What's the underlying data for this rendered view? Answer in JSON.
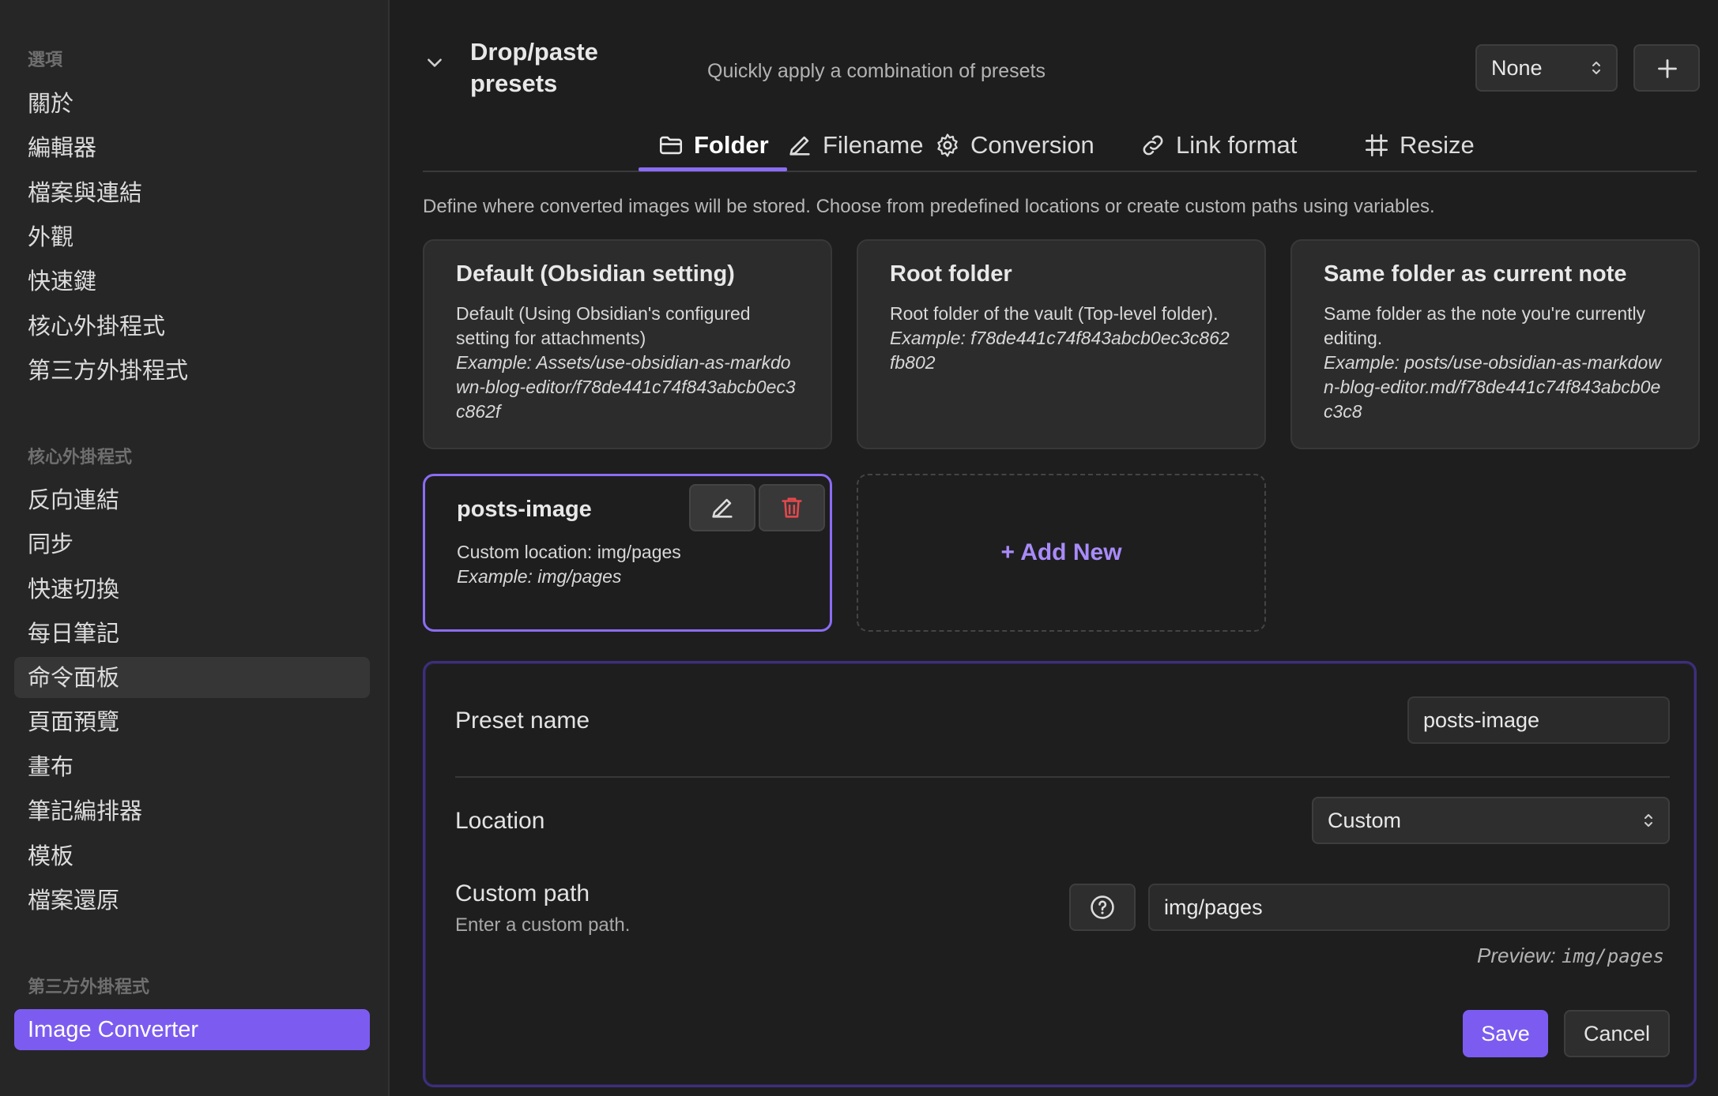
{
  "sidebar": {
    "sections": [
      {
        "heading": "選項",
        "items": [
          "關於",
          "編輯器",
          "檔案與連結",
          "外觀",
          "快速鍵",
          "核心外掛程式",
          "第三方外掛程式"
        ]
      },
      {
        "heading": "核心外掛程式",
        "items": [
          "反向連結",
          "同步",
          "快速切換",
          "每日筆記",
          "命令面板",
          "頁面預覽",
          "畫布",
          "筆記編排器",
          "模板",
          "檔案還原"
        ]
      },
      {
        "heading": "第三方外掛程式",
        "items": [
          "Image Converter"
        ]
      }
    ]
  },
  "header": {
    "title": "Drop/paste presets",
    "description": "Quickly apply a combination of presets",
    "preset_select": "None"
  },
  "tabs": [
    {
      "label": "Folder",
      "icon": "folder-icon",
      "active": true
    },
    {
      "label": "Filename",
      "icon": "pencil-icon"
    },
    {
      "label": "Conversion",
      "icon": "gear-icon"
    },
    {
      "label": "Link format",
      "icon": "link-icon"
    },
    {
      "label": "Resize",
      "icon": "crop-icon"
    }
  ],
  "section_description": "Define where converted images will be stored. Choose from predefined locations or create custom paths using variables.",
  "cards": [
    {
      "title": "Default (Obsidian setting)",
      "text": "Default (Using Obsidian's configured setting for attachments)",
      "example": "Example: Assets/use-obsidian-as-markdown-blog-editor/f78de441c74f843abcb0ec3c862f"
    },
    {
      "title": "Root folder",
      "text": "Root folder of the vault (Top-level folder).",
      "example": "Example: f78de441c74f843abcb0ec3c862fb802"
    },
    {
      "title": "Same folder as current note",
      "text": "Same folder as the note you're currently editing.",
      "example": "Example: posts/use-obsidian-as-markdown-blog-editor.md/f78de441c74f843abcb0ec3c8"
    },
    {
      "title": "posts-image",
      "text": "Custom location: img/pages",
      "example": "Example: img/pages"
    }
  ],
  "add_new_label": "+ Add New",
  "form": {
    "preset_name_label": "Preset name",
    "preset_name_value": "posts-image",
    "location_label": "Location",
    "location_value": "Custom",
    "custom_path_label": "Custom path",
    "custom_path_sub": "Enter a custom path.",
    "custom_path_value": "img/pages",
    "preview_label": "Preview:",
    "preview_value": "img/pages",
    "save_label": "Save",
    "cancel_label": "Cancel"
  },
  "colors": {
    "accent": "#7c5cf0",
    "accent_text": "#a88bfa",
    "delete": "#e5484d"
  }
}
